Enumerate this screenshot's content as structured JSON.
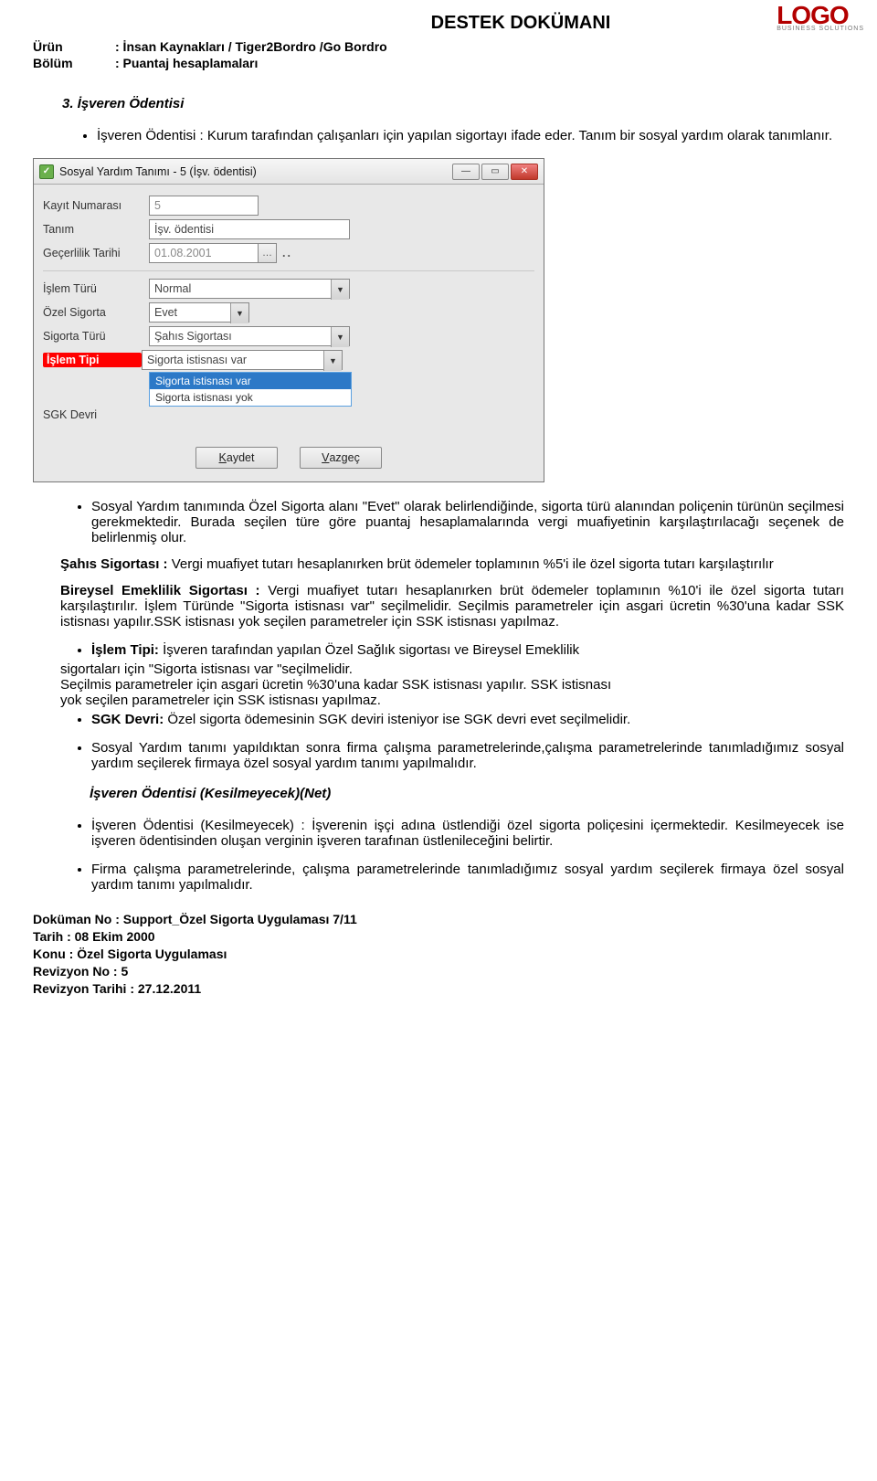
{
  "header": {
    "title": "DESTEK DOKÜMANI",
    "logo_main": "LOGO",
    "logo_sub": "BUSINESS SOLUTIONS",
    "meta": {
      "urun_label": "Ürün",
      "urun_value": ": İnsan Kaynakları / Tiger2Bordro /Go Bordro",
      "bolum_label": "Bölüm",
      "bolum_value": ": Puantaj hesaplamaları"
    }
  },
  "section": {
    "number_title": "3.   İşveren Ödentisi",
    "intro_bullet": "İşveren Ödentisi : Kurum tarafından çalışanları için yapılan sigortayı ifade eder. Tanım bir sosyal yardım olarak tanımlanır."
  },
  "window": {
    "title": "Sosyal Yardım Tanımı - 5 (İşv. ödentisi)",
    "labels": {
      "kayit_no": "Kayıt Numarası",
      "tanim": "Tanım",
      "gecerlilik": "Geçerlilik Tarihi",
      "islem_turu": "İşlem Türü",
      "ozel_sigorta": "Özel Sigorta",
      "sigorta_turu": "Sigorta Türü",
      "islem_tipi": "İşlem Tipi",
      "sgk_devri": "SGK Devri"
    },
    "values": {
      "kayit_no": "5",
      "tanim": "İşv. ödentisi",
      "gecerlilik": "01.08.2001",
      "islem_turu": "Normal",
      "ozel_sigorta": "Evet",
      "sigorta_turu": "Şahıs Sigortası",
      "islem_tipi": "Sigorta istisnası var"
    },
    "dropdown_options": {
      "opt1": "Sigorta istisnası var",
      "opt2": "Sigorta istisnası yok"
    },
    "buttons": {
      "save": "Kaydet",
      "cancel": "Vazgeç"
    }
  },
  "body": {
    "bullet_after_window": "Sosyal Yardım tanımında Özel Sigorta alanı \"Evet\" olarak belirlendiğinde, sigorta türü alanından poliçenin türünün seçilmesi gerekmektedir.  Burada seçilen türe göre puantaj hesaplamalarında vergi muafiyetinin karşılaştırılacağı seçenek de belirlenmiş olur.",
    "sahis_head": "Şahıs Sigortası :",
    "sahis_text": " Vergi muafiyet tutarı hesaplanırken brüt ödemeler toplamının %5'i ile özel sigorta tutarı karşılaştırılır",
    "bireysel_head": "Bireysel Emeklilik Sigortası :",
    "bireysel_text": " Vergi muafiyet tutarı hesaplanırken brüt ödemeler toplamının %10'i ile özel sigorta tutarı karşılaştırılır. İşlem Türünde \"Sigorta istisnası var\" seçilmelidir. Seçilmis parametreler için asgari ücretin %30'una kadar SSK istisnası yapılır.SSK istisnası yok seçilen parametreler için SSK istisnası yapılmaz.",
    "islem_tipi_head": "İşlem Tipi:",
    "islem_tipi_text": " İşveren tarafından yapılan Özel Sağlık sigortası ve Bireysel Emeklilik",
    "islem_tipi_rest1": "sigortaları için \"Sigorta istisnası var \"seçilmelidir.",
    "islem_tipi_rest2": "Seçilmis parametreler için asgari ücretin %30'una kadar SSK istisnası yapılır. SSK istisnası",
    "islem_tipi_rest3": "yok seçilen parametreler için SSK istisnası yapılmaz.",
    "sgk_head": "SGK Devri:",
    "sgk_text": " Özel sigorta ödemesinin SGK deviri isteniyor ise SGK devri evet seçilmelidir.",
    "sosyal_yardim_paragraph": "Sosyal Yardım tanımı yapıldıktan sonra firma çalışma parametrelerinde,çalışma parametrelerinde tanımladığımız sosyal yardım seçilerek firmaya özel sosyal yardım tanımı yapılmalıdır.",
    "subhead": "İşveren Ödentisi  (Kesilmeyecek)(Net)",
    "kesilmeyecek_text": "İşveren Ödentisi (Kesilmeyecek) : İşverenin işçi adına üstlendiği özel sigorta poliçesini içermektedir. Kesilmeyecek ise işveren ödentisinden oluşan verginin işveren tarafınan üstlenileceğini belirtir.",
    "firma_text": "Firma çalışma parametrelerinde, çalışma parametrelerinde tanımladığımız  sosyal yardım seçilerek firmaya özel sosyal yardım tanımı yapılmalıdır."
  },
  "footer": {
    "l1": "Doküman No : Support_Özel Sigorta Uygulaması   7/11",
    "l2": "Tarih : 08 Ekim 2000",
    "l3": "Konu : Özel Sigorta Uygulaması",
    "l4": "Revizyon No : 5",
    "l5": "Revizyon Tarihi : 27.12.2011"
  }
}
